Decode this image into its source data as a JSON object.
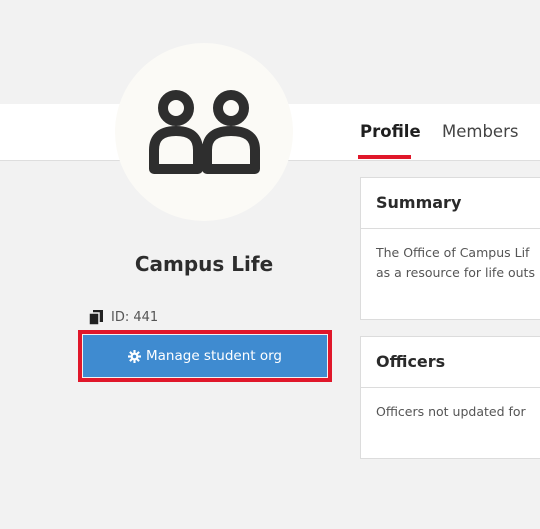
{
  "org": {
    "name": "Campus Life",
    "id_label": "ID: 441",
    "manage_button_label": "Manage student org",
    "avatar_icon": "people-group-icon"
  },
  "tabs": [
    {
      "label": "Profile",
      "active": true
    },
    {
      "label": "Members",
      "active": false
    }
  ],
  "summary": {
    "title": "Summary",
    "lines": [
      "The Office of Campus Lif",
      "as a resource for life outs"
    ]
  },
  "officers": {
    "title": "Officers",
    "text": "Officers not updated for"
  },
  "colors": {
    "accent_red": "#e0172a",
    "button_blue": "#3f8bd0",
    "background": "#f2f2f2"
  }
}
